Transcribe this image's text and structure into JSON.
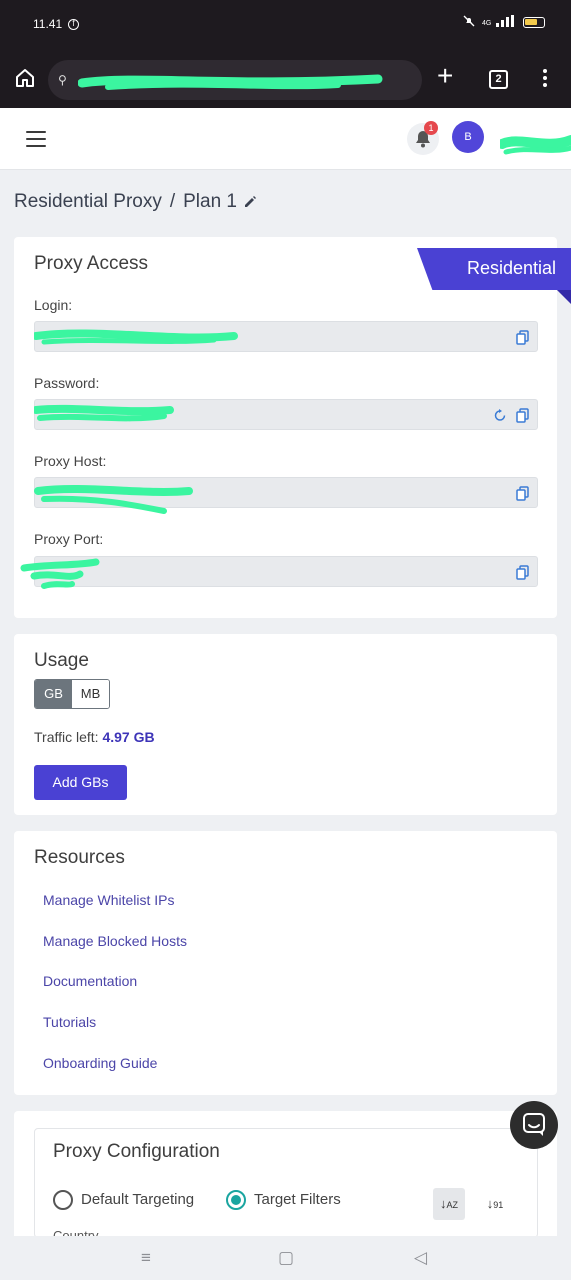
{
  "statusbar": {
    "time": "11.41",
    "battery_level": "55"
  },
  "browser": {
    "tab_count": "2"
  },
  "header": {
    "notification_count": "1",
    "avatar_initial": "B"
  },
  "breadcrumb": {
    "part1": "Residential Proxy",
    "separator": "/",
    "part2": "Plan 1"
  },
  "proxy_access": {
    "title": "Proxy Access",
    "badge": "Residential",
    "login_label": "Login:",
    "password_label": "Password:",
    "host_label": "Proxy Host:",
    "port_label": "Proxy Port:"
  },
  "usage": {
    "title": "Usage",
    "unit_gb": "GB",
    "unit_mb": "MB",
    "traffic_label": "Traffic left:",
    "traffic_value": "4.97 GB",
    "add_button": "Add GBs"
  },
  "resources": {
    "title": "Resources",
    "links": [
      "Manage Whitelist IPs",
      "Manage Blocked Hosts",
      "Documentation",
      "Tutorials",
      "Onboarding Guide"
    ]
  },
  "config": {
    "title": "Proxy Configuration",
    "option_default": "Default Targeting",
    "option_filters": "Target Filters",
    "country_label": "Country"
  },
  "colors": {
    "accent": "#4a41d3",
    "selected_radio": "#1aa5a0",
    "redaction": "#3bf5a0"
  }
}
